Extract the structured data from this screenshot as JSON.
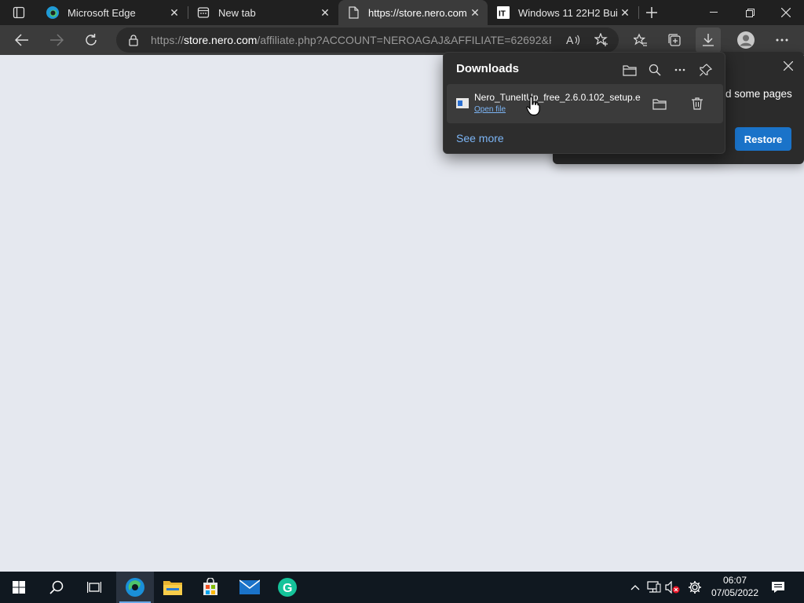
{
  "tabs": [
    {
      "title": "Microsoft Edge",
      "active": false
    },
    {
      "title": "New tab",
      "active": false
    },
    {
      "title": "https://store.nero.com/affiliate.php",
      "active": true
    },
    {
      "title": "Windows 11 22H2 Build",
      "active": false
    }
  ],
  "address": {
    "prefix": "https://",
    "domain": "store.nero.com",
    "path": "/affiliate.php?ACCOUNT=NEROAGAJ&AFFILIATE=62692&P..."
  },
  "downloads": {
    "title": "Downloads",
    "filename": "Nero_TuneItUp_free_2.6.0.102_setup.exe",
    "open_file": "Open file",
    "see_more": "See more"
  },
  "restore": {
    "text": "d some pages",
    "button": "Restore"
  },
  "clock": {
    "time": "06:07",
    "date": "07/05/2022"
  },
  "colors": {
    "accent": "#1a73c9",
    "link": "#7cb5f5",
    "page_bg": "#e5e8ef"
  }
}
